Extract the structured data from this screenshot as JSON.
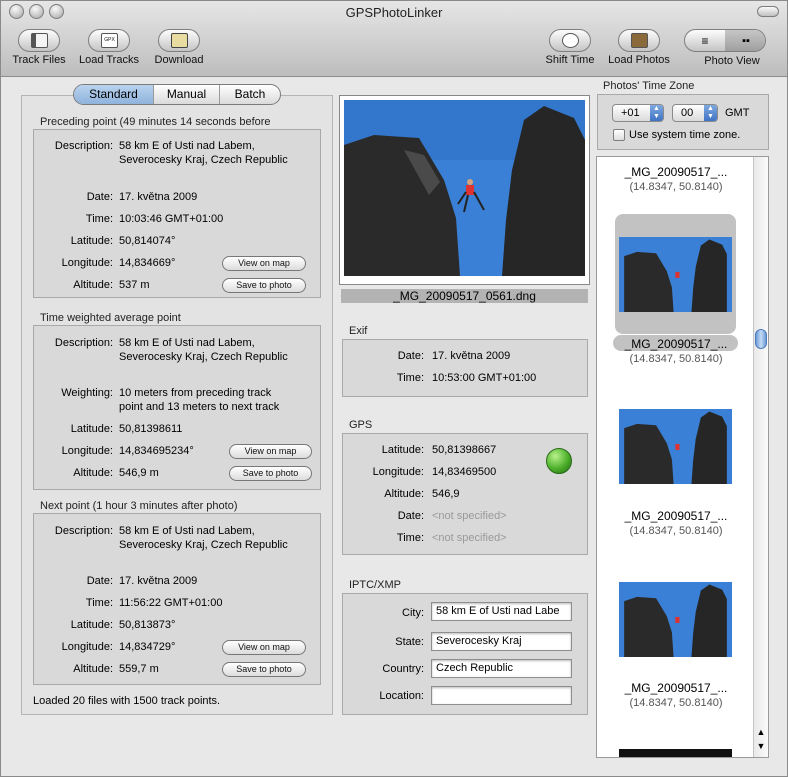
{
  "window": {
    "title": "GPSPhotoLinker"
  },
  "toolbar": {
    "track_files": "Track Files",
    "load_tracks": "Load Tracks",
    "download": "Download",
    "shift_time": "Shift Time",
    "load_photos": "Load Photos",
    "photo_view": "Photo View",
    "gpx_badge": "GPX"
  },
  "tabs": {
    "standard": "Standard",
    "manual": "Manual",
    "batch": "Batch",
    "selected": "Standard"
  },
  "preceding": {
    "heading": "Preceding point (49 minutes 14 seconds before",
    "description_label": "Description:",
    "description": "58 km E  of Usti nad Labem,",
    "description2": "Severocesky Kraj, Czech Republic",
    "date_label": "Date:",
    "date": "17. května 2009",
    "time_label": "Time:",
    "time": "10:03:46 GMT+01:00",
    "lat_label": "Latitude:",
    "lat": "50,814074°",
    "lon_label": "Longitude:",
    "lon": "14,834669°",
    "alt_label": "Altitude:",
    "alt": "537 m",
    "view_map": "View on map",
    "save_photo": "Save to photo"
  },
  "average": {
    "heading": "Time weighted average point",
    "description_label": "Description:",
    "description": "58 km E  of Usti nad Labem,",
    "description2": "Severocesky Kraj, Czech Republic",
    "weighting_label": "Weighting:",
    "weighting": "10 meters from preceding track",
    "weighting2": "point and 13 meters to next track",
    "lat_label": "Latitude:",
    "lat": "50,81398611",
    "lon_label": "Longitude:",
    "lon": "14,834695234°",
    "alt_label": "Altitude:",
    "alt": "546,9 m",
    "view_map": "View on map",
    "save_photo": "Save to photo"
  },
  "next": {
    "heading": "Next point (1 hour 3 minutes after photo)",
    "description_label": "Description:",
    "description": "58 km E  of Usti nad Labem,",
    "description2": "Severocesky Kraj, Czech Republic",
    "date_label": "Date:",
    "date": "17. května 2009",
    "time_label": "Time:",
    "time": "11:56:22 GMT+01:00",
    "lat_label": "Latitude:",
    "lat": "50,813873°",
    "lon_label": "Longitude:",
    "lon": "14,834729°",
    "alt_label": "Altitude:",
    "alt": "559,7 m",
    "view_map": "View on map",
    "save_photo": "Save to photo"
  },
  "status": "Loaded 20 files with 1500 track points.",
  "preview": {
    "filename": "_MG_20090517_0561.dng"
  },
  "exif": {
    "heading": "Exif",
    "date_label": "Date:",
    "date": "17. května 2009",
    "time_label": "Time:",
    "time": "10:53:00 GMT+01:00"
  },
  "gps": {
    "heading": "GPS",
    "lat_label": "Latitude:",
    "lat": "50,81398667",
    "lon_label": "Longitude:",
    "lon": "14,83469500",
    "alt_label": "Altitude:",
    "alt": "546,9",
    "date_label": "Date:",
    "date": "<not specified>",
    "time_label": "Time:",
    "time": "<not specified>"
  },
  "iptc": {
    "heading": "IPTC/XMP",
    "city_label": "City:",
    "city": "58 km E  of Usti nad Labe",
    "state_label": "State:",
    "state": "Severocesky Kraj",
    "country_label": "Country:",
    "country": "Czech Republic",
    "location_label": "Location:",
    "location": ""
  },
  "timezone": {
    "heading": "Photos' Time Zone",
    "hours": "+01",
    "minutes": "00",
    "gmt": "GMT",
    "use_system": "Use system time zone.",
    "use_system_checked": false
  },
  "photos": [
    {
      "name": "_MG_20090517_...",
      "coords": "(14.8347, 50.8140)",
      "selected": false
    },
    {
      "name": "_MG_20090517_...",
      "coords": "(14.8347, 50.8140)",
      "selected": true
    },
    {
      "name": "_MG_20090517_...",
      "coords": "(14.8347, 50.8140)",
      "selected": false
    },
    {
      "name": "_MG_20090517_...",
      "coords": "(14.8347, 50.8140)",
      "selected": false
    }
  ],
  "colors": {
    "sky": "#3a80d6",
    "rock": "#2a2a2a",
    "selection": "#b9d3ee",
    "globe": "#4caf2a"
  }
}
